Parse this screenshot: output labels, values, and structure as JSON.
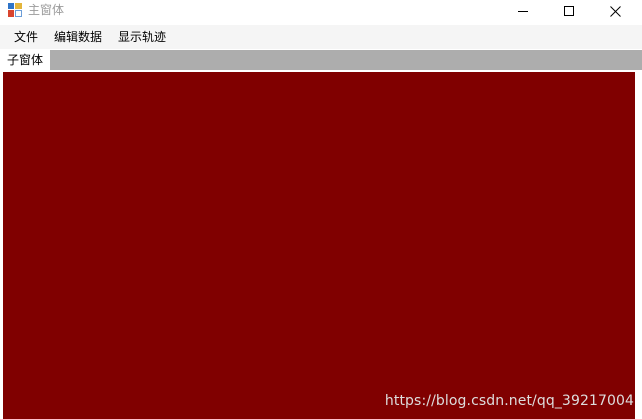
{
  "window": {
    "title": "主窗体",
    "icon": "form-app-icon"
  },
  "title_controls": {
    "minimize": "minimize-icon",
    "maximize": "maximize-icon",
    "close": "close-icon"
  },
  "menubar": {
    "items": [
      {
        "label": "文件"
      },
      {
        "label": "编辑数据"
      },
      {
        "label": "显示轨迹"
      }
    ]
  },
  "tabs": [
    {
      "label": "子窗体",
      "active": true
    }
  ],
  "child": {
    "background": "#800000"
  },
  "watermark": {
    "text": "https://blog.csdn.net/qq_39217004"
  }
}
